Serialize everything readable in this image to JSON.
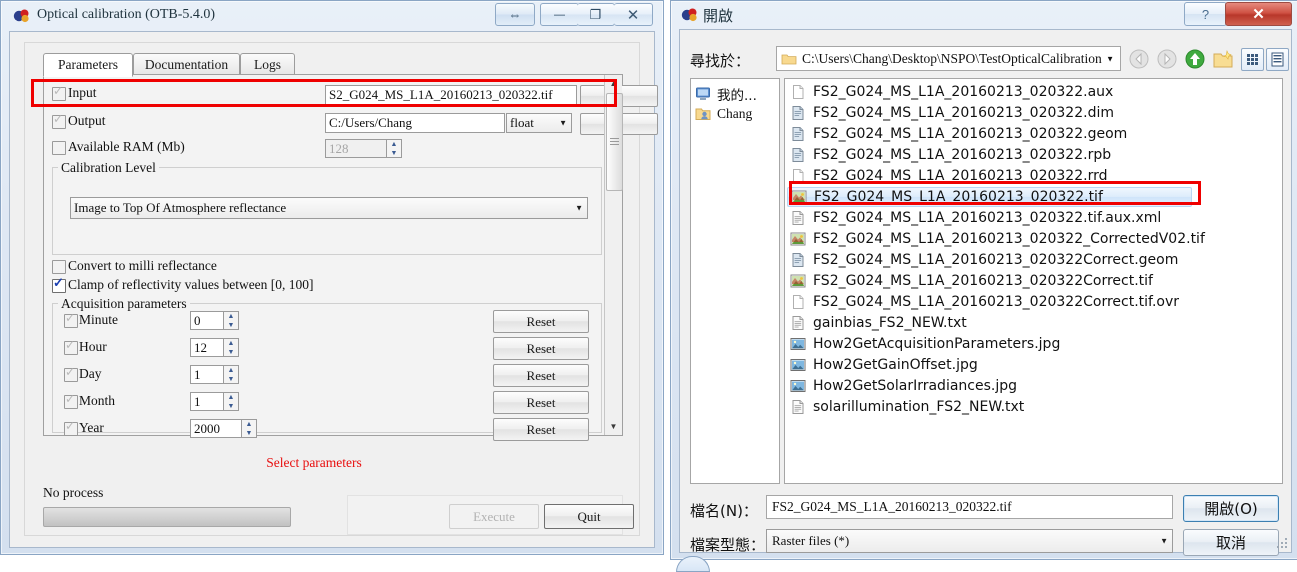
{
  "left_window": {
    "title": "Optical calibration (OTB-5.4.0)",
    "app_icon": "otb-logo-icon",
    "titlebar_buttons": [
      {
        "name": "resize-horizontal-button",
        "glyph": "⇔"
      },
      {
        "name": "minimize-button",
        "glyph": "—"
      },
      {
        "name": "maximize-button",
        "glyph": "❐"
      },
      {
        "name": "close-button",
        "glyph": "✕"
      }
    ],
    "tabs": [
      {
        "label": "Parameters",
        "active": true
      },
      {
        "label": "Documentation",
        "active": false
      },
      {
        "label": "Logs",
        "active": false
      }
    ],
    "input_row": {
      "checkbox_label": "Input",
      "value": "S2_G024_MS_L1A_20160213_020322.tif",
      "browse_label": "...",
      "checked": true,
      "highlighted": true
    },
    "output_row": {
      "checkbox_label": "Output",
      "value": "C:/Users/Chang",
      "type_value": "float",
      "browse_label": "...",
      "checked": true
    },
    "ram_row": {
      "checkbox_label": "Available RAM (Mb)",
      "value": "128",
      "checked": false
    },
    "calibration_group": {
      "title": "Calibration Level",
      "selected": "Image to Top Of Atmosphere reflectance"
    },
    "convert_milli": {
      "label": "Convert to milli reflectance",
      "checked": false
    },
    "clamp": {
      "label": "Clamp of reflectivity values between [0, 100]",
      "checked": true
    },
    "acquisition_group": {
      "title": "Acquisition parameters",
      "reset_label": "Reset",
      "rows": [
        {
          "label": "Minute",
          "value": "0",
          "checked": true
        },
        {
          "label": "Hour",
          "value": "12",
          "checked": true
        },
        {
          "label": "Day",
          "value": "1",
          "checked": true
        },
        {
          "label": "Month",
          "value": "1",
          "checked": true
        },
        {
          "label": "Year",
          "value": "2000",
          "checked": true
        }
      ]
    },
    "select_parameters_note": "Select parameters",
    "progress_label": "No process",
    "execute_label": "Execute",
    "quit_label": "Quit"
  },
  "right_window": {
    "title": "開啟",
    "app_icon": "otb-logo-icon",
    "titlebar_buttons": [
      {
        "name": "help-button",
        "glyph": "?"
      },
      {
        "name": "close-button",
        "glyph": "✕"
      }
    ],
    "look_in_label": "尋找於：",
    "look_in_path": "C:\\Users\\Chang\\Desktop\\NSPO\\TestOpticalCalibration",
    "toolbar_icons": [
      {
        "name": "back-icon",
        "glyph": "back"
      },
      {
        "name": "forward-icon",
        "glyph": "forward"
      },
      {
        "name": "parent-folder-icon",
        "glyph": "up"
      },
      {
        "name": "new-folder-icon",
        "glyph": "newfolder"
      },
      {
        "name": "icon-view-button",
        "glyph": "grid"
      },
      {
        "name": "detail-view-button",
        "glyph": "list"
      }
    ],
    "places": [
      {
        "label": "我的...",
        "icon": "computer-icon"
      },
      {
        "label": "Chang",
        "icon": "user-folder-icon"
      }
    ],
    "files": [
      {
        "name": "FS2_G024_MS_L1A_20160213_020322.aux",
        "icon": "blank-file-icon",
        "selected": false
      },
      {
        "name": "FS2_G024_MS_L1A_20160213_020322.dim",
        "icon": "document-file-icon",
        "selected": false
      },
      {
        "name": "FS2_G024_MS_L1A_20160213_020322.geom",
        "icon": "document-file-icon",
        "selected": false
      },
      {
        "name": "FS2_G024_MS_L1A_20160213_020322.rpb",
        "icon": "document-file-icon",
        "selected": false
      },
      {
        "name": "FS2_G024_MS_L1A_20160213_020322.rrd",
        "icon": "blank-file-icon",
        "selected": false
      },
      {
        "name": "FS2_G024_MS_L1A_20160213_020322.tif",
        "icon": "image-file-icon",
        "selected": true
      },
      {
        "name": "FS2_G024_MS_L1A_20160213_020322.tif.aux.xml",
        "icon": "text-file-icon",
        "selected": false
      },
      {
        "name": "FS2_G024_MS_L1A_20160213_020322_CorrectedV02.tif",
        "icon": "image-file-icon",
        "selected": false
      },
      {
        "name": "FS2_G024_MS_L1A_20160213_020322Correct.geom",
        "icon": "document-file-icon",
        "selected": false
      },
      {
        "name": "FS2_G024_MS_L1A_20160213_020322Correct.tif",
        "icon": "image-file-icon",
        "selected": false
      },
      {
        "name": "FS2_G024_MS_L1A_20160213_020322Correct.tif.ovr",
        "icon": "blank-file-icon",
        "selected": false
      },
      {
        "name": "gainbias_FS2_NEW.txt",
        "icon": "text-file-icon",
        "selected": false
      },
      {
        "name": "How2GetAcquisitionParameters.jpg",
        "icon": "photo-file-icon",
        "selected": false
      },
      {
        "name": "How2GetGainOffset.jpg",
        "icon": "photo-file-icon",
        "selected": false
      },
      {
        "name": "How2GetSolarIrradiances.jpg",
        "icon": "photo-file-icon",
        "selected": false
      },
      {
        "name": "solarillumination_FS2_NEW.txt",
        "icon": "text-file-icon",
        "selected": false
      }
    ],
    "filename_label": "檔名(N)：",
    "filename_value": "FS2_G024_MS_L1A_20160213_020322.tif",
    "filetype_label": "檔案型態：",
    "filetype_value": "Raster files (*)",
    "open_button": "開啟(O)",
    "cancel_button": "取消"
  },
  "colors": {
    "highlight_red": "#ef0000",
    "note_red": "#e81010",
    "window_chrome": "#d4e0ef",
    "selection_blue": "#cfe4fa"
  }
}
